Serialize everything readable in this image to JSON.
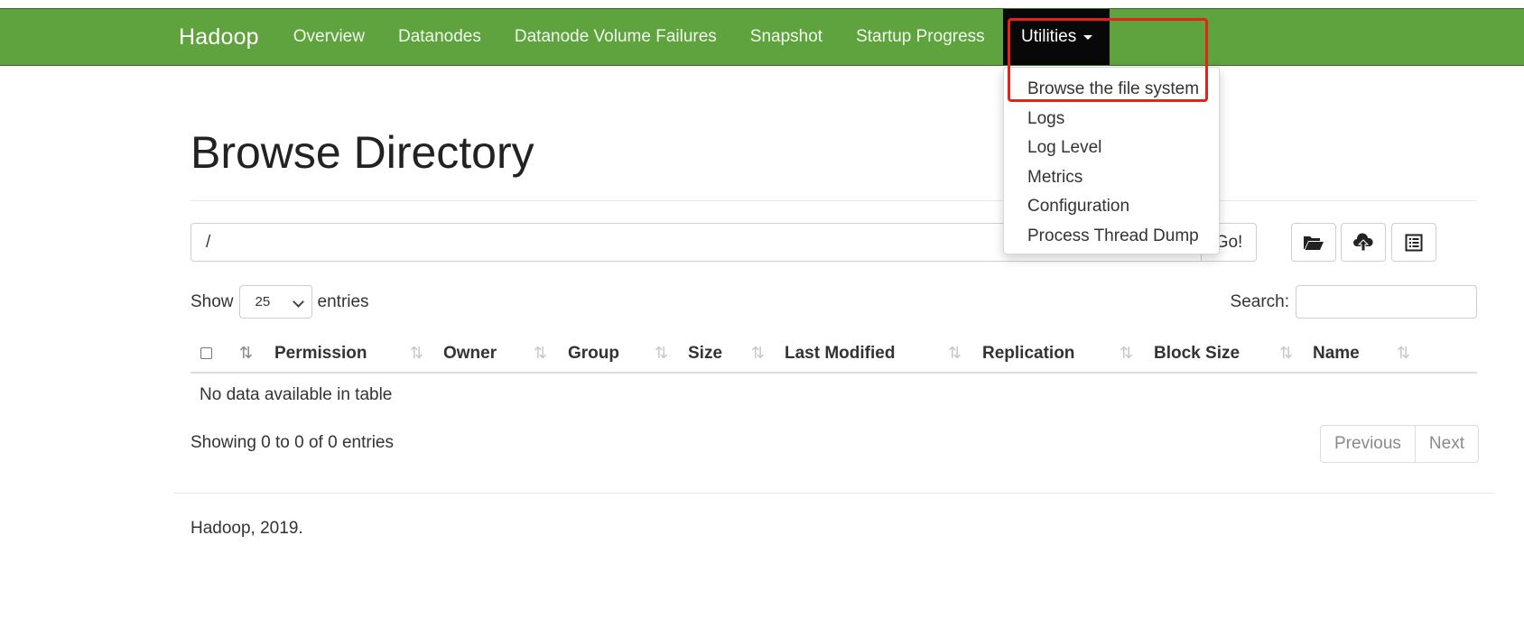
{
  "navbar": {
    "brand": "Hadoop",
    "links": [
      "Overview",
      "Datanodes",
      "Datanode Volume Failures",
      "Snapshot",
      "Startup Progress"
    ],
    "active": "Utilities",
    "background": "#5fa33e"
  },
  "dropdown": {
    "items": [
      "Browse the file system",
      "Logs",
      "Log Level",
      "Metrics",
      "Configuration",
      "Process Thread Dump"
    ]
  },
  "page": {
    "title": "Browse Directory",
    "path_value": "/",
    "go_label": "Go!",
    "tools": [
      "folder-open-icon",
      "cloud-upload-icon",
      "list-alt-icon"
    ]
  },
  "table_controls": {
    "show_label": "Show",
    "page_length": "25",
    "entries_label": "entries",
    "search_label": "Search:"
  },
  "table": {
    "columns": [
      "Permission",
      "Owner",
      "Group",
      "Size",
      "Last Modified",
      "Replication",
      "Block Size",
      "Name"
    ],
    "empty_message": "No data available in table",
    "info": "Showing 0 to 0 of 0 entries",
    "prev_label": "Previous",
    "next_label": "Next"
  },
  "footer": {
    "text": "Hadoop, 2019."
  },
  "annotation": {
    "highlight_color": "#e4241b"
  }
}
